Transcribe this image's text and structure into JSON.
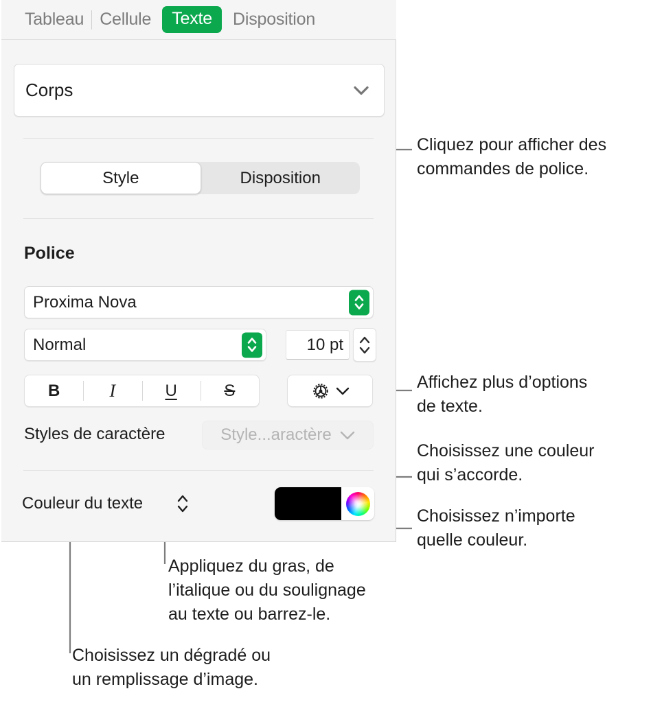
{
  "panel": {
    "tabs": [
      {
        "label": "Tableau",
        "selected": false
      },
      {
        "label": "Cellule",
        "selected": false
      },
      {
        "label": "Texte",
        "selected": true
      },
      {
        "label": "Disposition",
        "selected": false
      }
    ],
    "paragraph_style": {
      "value": "Corps",
      "icon": "chevron-down-icon"
    },
    "segmented": {
      "options": [
        "Style",
        "Disposition"
      ],
      "selected": "Style"
    },
    "font_section": {
      "heading": "Police",
      "family": "Proxima Nova",
      "weight": "Normal",
      "size": "10 pt",
      "format_buttons": [
        {
          "name": "bold",
          "glyph": "B"
        },
        {
          "name": "italic",
          "glyph": "I"
        },
        {
          "name": "underline",
          "glyph": "U"
        },
        {
          "name": "strikethrough",
          "glyph": "S"
        }
      ],
      "more_options_icon": "gear-icon"
    },
    "character_styles": {
      "label": "Styles de caractère",
      "popup_value": "Style...aractère"
    },
    "text_color": {
      "label": "Couleur du texte",
      "swatch_color": "#000000",
      "wheel_icon": "color-wheel-icon"
    }
  },
  "callouts": {
    "font_commands": "Cliquez pour afficher des\ncommandes de police.",
    "more_text_options": "Affichez plus d’options\nde texte.",
    "matching_color": "Choisissez une couleur\nqui s’accorde.",
    "any_color": "Choisissez n’importe\nquelle couleur.",
    "bold_italic": "Appliquez du gras, de\nl’italique ou du soulignage\nau texte ou barrez-le.",
    "gradient_fill": "Choisissez un dégradé ou\nun remplissage d’image."
  },
  "colors": {
    "accent_green": "#0ba84e",
    "panel_background": "#f5f5f5",
    "text_primary": "#1d1d1d",
    "text_muted": "#7c7c7c",
    "leader_line": "#7d7d7d"
  }
}
